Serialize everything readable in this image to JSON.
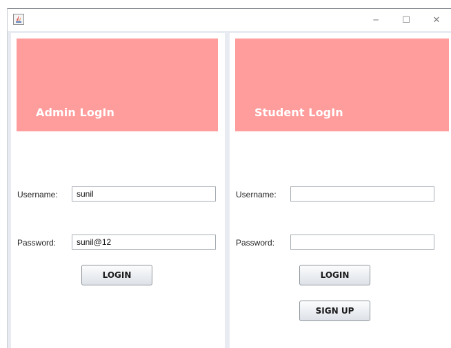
{
  "window": {
    "controls": {
      "minimize": "─",
      "maximize": "☐",
      "close": "✕"
    }
  },
  "admin": {
    "title": "Admin LogIn",
    "username_label": "Username:",
    "username_value": "sunil",
    "password_label": "Password:",
    "password_value": "sunil@12",
    "login_label": "LOGIN"
  },
  "student": {
    "title": "Student LogIn",
    "username_label": "Username:",
    "username_value": "",
    "password_label": "Password:",
    "password_value": "",
    "login_label": "LOGIN",
    "signup_label": "SIGN UP"
  },
  "colors": {
    "header": "#ff9c9c",
    "header_text": "#ffffff",
    "background": "#e8ecf2"
  }
}
